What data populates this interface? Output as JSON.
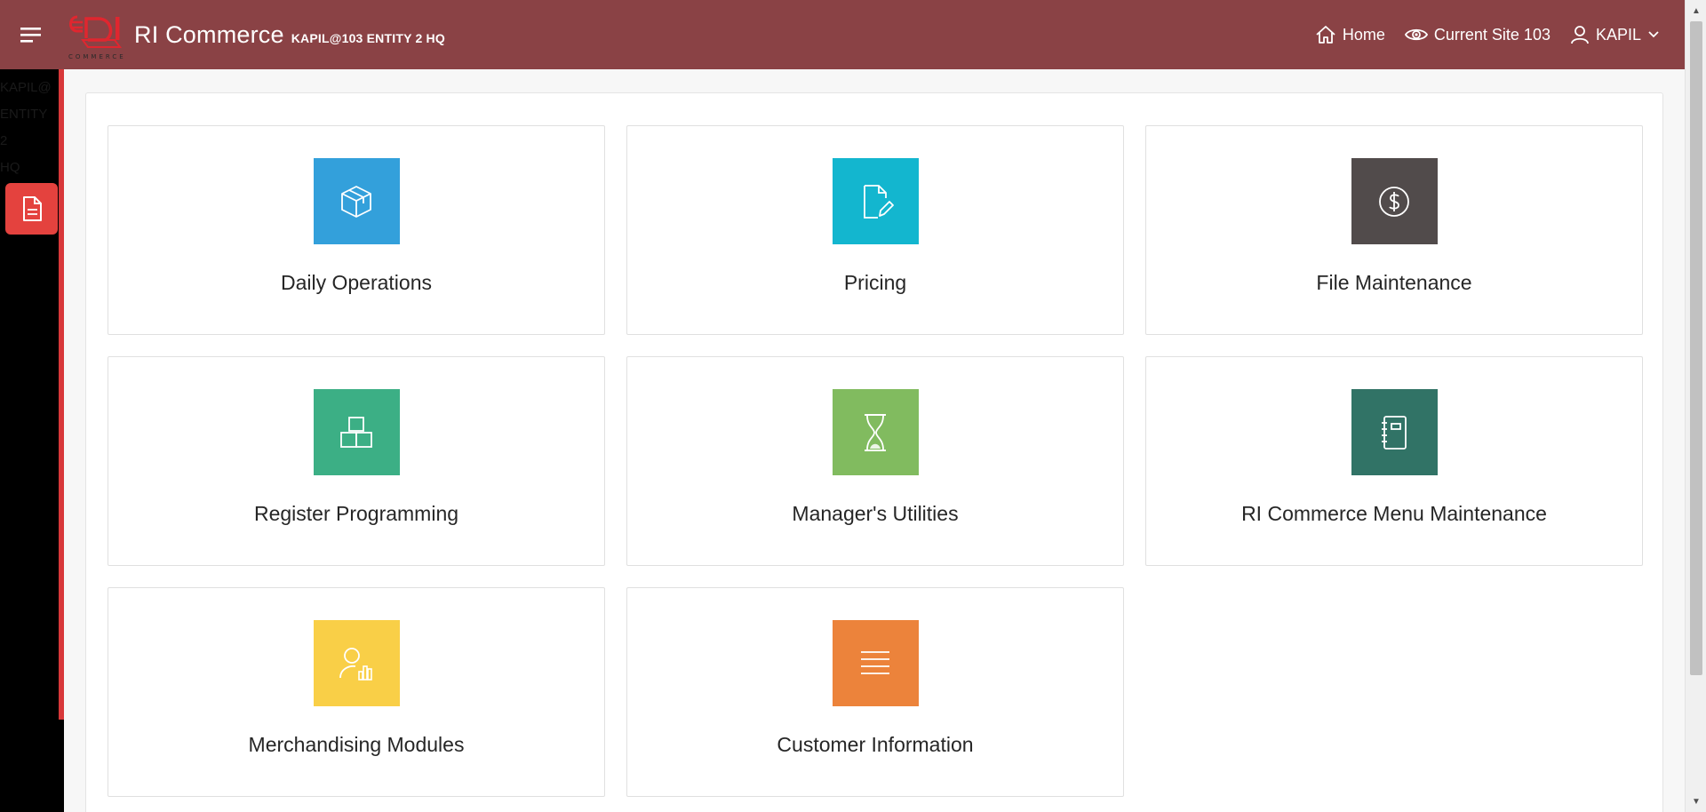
{
  "header": {
    "app_title": "RI Commerce",
    "entity_label": "KAPIL@103 ENTITY 2 HQ",
    "nav": {
      "home_label": "Home",
      "site_label": "Current Site 103",
      "user_label": "KAPIL"
    }
  },
  "sidebar": {
    "text_lines": [
      "KAPIL@",
      "ENTITY",
      "2",
      "HQ"
    ]
  },
  "cards": [
    {
      "label": "Daily Operations",
      "icon": "box-icon",
      "color": "#33a0db"
    },
    {
      "label": "Pricing",
      "icon": "document-edit-icon",
      "color": "#13b6cf"
    },
    {
      "label": "File Maintenance",
      "icon": "dollar-circle-icon",
      "color": "#514b4b"
    },
    {
      "label": "Register Programming",
      "icon": "stacked-boxes-icon",
      "color": "#3caf85"
    },
    {
      "label": "Manager's Utilities",
      "icon": "hourglass-icon",
      "color": "#81bb5f"
    },
    {
      "label": "RI Commerce Menu Maintenance",
      "icon": "notebook-icon",
      "color": "#317366"
    },
    {
      "label": "Merchandising Modules",
      "icon": "user-chart-icon",
      "color": "#f9cf47"
    },
    {
      "label": "Customer Information",
      "icon": "list-lines-icon",
      "color": "#ec833b"
    }
  ],
  "colors": {
    "header_bg": "#8a4245",
    "sidebar_bg": "#000000",
    "sidebar_accent": "#e4423e"
  }
}
